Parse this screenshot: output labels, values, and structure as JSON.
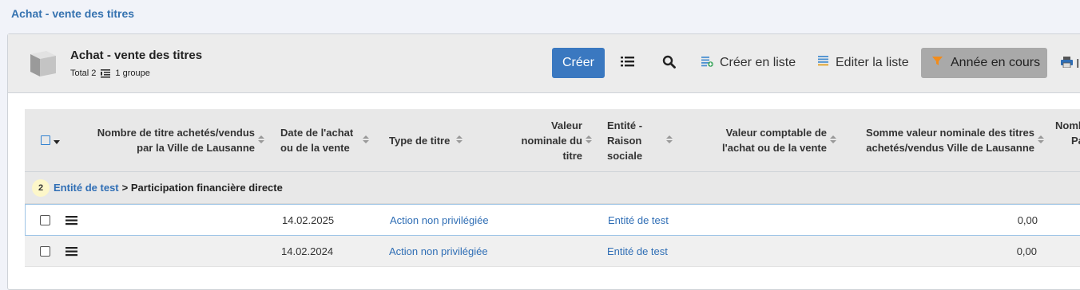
{
  "breadcrumb": "Achat - vente des titres",
  "header": {
    "title": "Achat - vente des titres",
    "total": "Total 2",
    "groups": "1 groupe"
  },
  "toolbar": {
    "create_label": "Créer",
    "create_list_label": "Créer en liste",
    "edit_list_label": "Editer la liste",
    "filter_label": "Année en cours",
    "print_partial": "I"
  },
  "columns": {
    "col1": [
      "Nombre de titre achetés/vendus",
      "par la Ville de Lausanne"
    ],
    "col2": [
      "Date de l'achat",
      "ou de la vente"
    ],
    "col3": [
      "Type de titre"
    ],
    "col4": [
      "Valeur",
      "nominale du",
      "titre"
    ],
    "col5": [
      "Entité -",
      "Raison",
      "sociale"
    ],
    "col6": [
      "Valeur comptable de",
      "l'achat ou de la vente"
    ],
    "col7": [
      "Somme valeur nominale des titres",
      "achetés/vendus Ville de Lausanne"
    ],
    "col8": [
      "Nomb",
      "Pa"
    ]
  },
  "group": {
    "count": "2",
    "link": "Entité de test",
    "rest": "> Participation financière directe"
  },
  "rows": [
    {
      "date": "14.02.2025",
      "type": "Action non privilégiée",
      "entity": "Entité de test",
      "sum": "0,00"
    },
    {
      "date": "14.02.2024",
      "type": "Action non privilégiée",
      "entity": "Entité de test",
      "sum": "0,00"
    }
  ],
  "colors": {
    "accent": "#3a78c0",
    "link": "#2f6eb5",
    "filter_icon": "#f28c1b"
  }
}
